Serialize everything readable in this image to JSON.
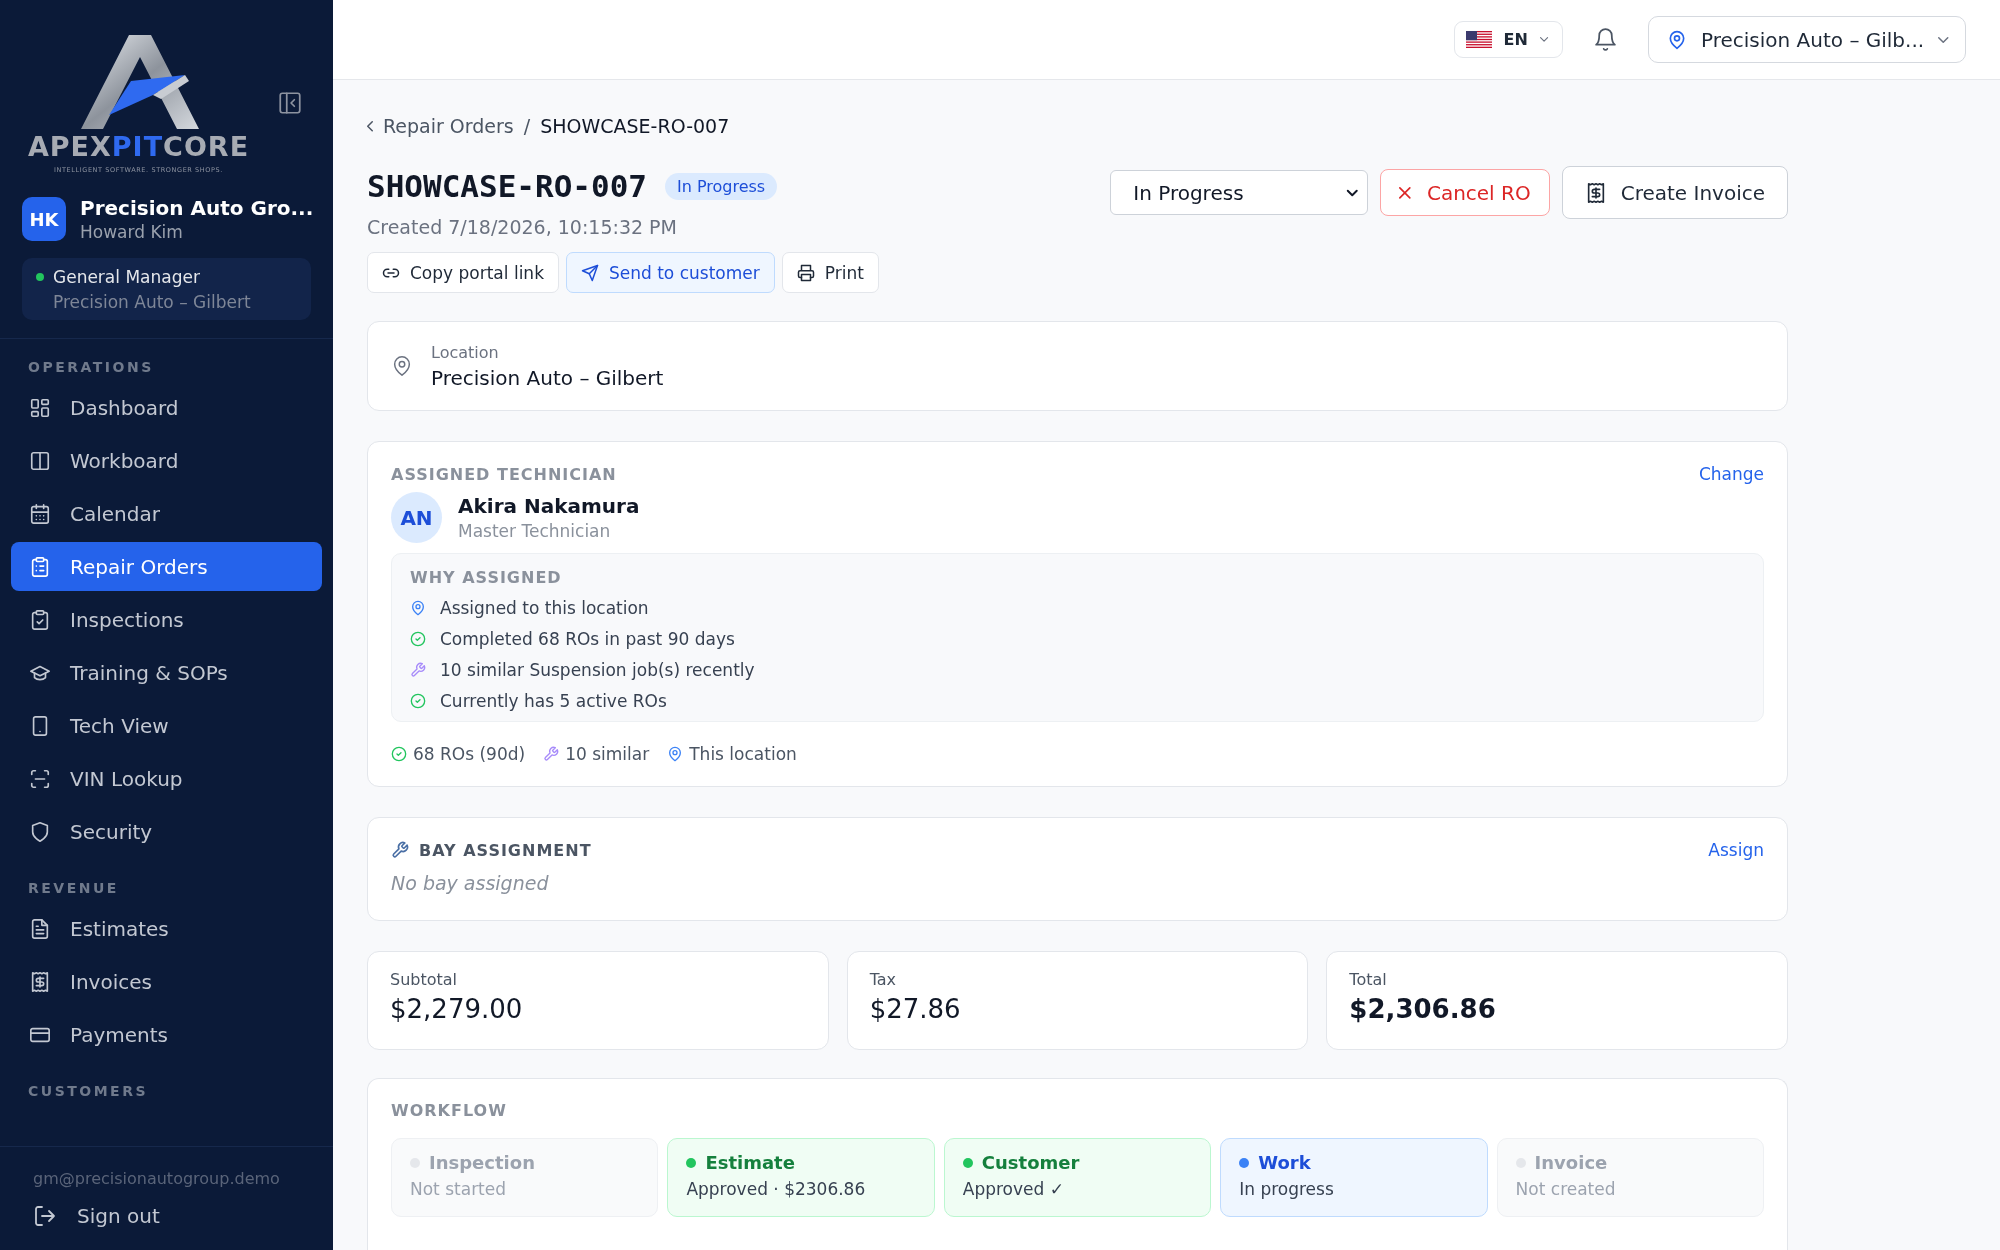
{
  "sidebar": {
    "logo": {
      "wordmark": [
        {
          "text": "APEX",
          "accent": false
        },
        {
          "text": "PIT",
          "accent": true
        },
        {
          "text": "CORE",
          "accent": false
        }
      ],
      "tagline": "INTELLIGENT SOFTWARE. STRONGER SHOPS."
    },
    "account": {
      "initials": "HK",
      "organization": "Precision Auto Gro...",
      "user": "Howard Kim"
    },
    "role": {
      "title": "General Manager",
      "location": "Precision Auto – Gilbert",
      "online": true
    },
    "sections": [
      {
        "heading": "OPERATIONS",
        "items": [
          {
            "label": "Dashboard",
            "selected": false
          },
          {
            "label": "Workboard",
            "selected": false
          },
          {
            "label": "Calendar",
            "selected": false
          },
          {
            "label": "Repair Orders",
            "selected": true
          },
          {
            "label": "Inspections",
            "selected": false
          },
          {
            "label": "Training & SOPs",
            "selected": false
          },
          {
            "label": "Tech View",
            "selected": false
          },
          {
            "label": "VIN Lookup",
            "selected": false
          },
          {
            "label": "Security",
            "selected": false
          }
        ]
      },
      {
        "heading": "REVENUE",
        "items": [
          {
            "label": "Estimates",
            "selected": false
          },
          {
            "label": "Invoices",
            "selected": false
          },
          {
            "label": "Payments",
            "selected": false
          }
        ]
      },
      {
        "heading": "CUSTOMERS"
      }
    ],
    "email": "gm@precisionautogroup.demo",
    "sign_out": "Sign out"
  },
  "topbar": {
    "language": "EN",
    "location": "Precision Auto – Gilb..."
  },
  "breadcrumb": {
    "parent": "Repair Orders",
    "separator": "/",
    "current": "SHOWCASE-RO-007"
  },
  "header": {
    "title": "SHOWCASE-RO-007",
    "status_badge": "In Progress",
    "created": "Created 7/18/2026, 10:15:32 PM",
    "status_select": "In Progress",
    "cancel_button": "Cancel RO",
    "invoice_button": "Create Invoice",
    "actions": [
      {
        "label": "Copy portal link",
        "kind": "link"
      },
      {
        "label": "Send to customer",
        "kind": "send"
      },
      {
        "label": "Print",
        "kind": "print"
      }
    ]
  },
  "location_card": {
    "label": "Location",
    "value": "Precision Auto – Gilbert"
  },
  "technician": {
    "heading": "ASSIGNED TECHNICIAN",
    "change_link": "Change",
    "initials": "AN",
    "name": "Akira Nakamura",
    "role": "Master Technician",
    "why_heading": "WHY ASSIGNED",
    "reasons": [
      {
        "kind": "location",
        "text": "Assigned to this location"
      },
      {
        "kind": "check",
        "text": "Completed 68 ROs in past 90 days"
      },
      {
        "kind": "similar",
        "text": "10 similar Suspension job(s) recently"
      },
      {
        "kind": "check",
        "text": "Currently has 5 active ROs"
      }
    ],
    "stats": [
      {
        "kind": "check",
        "text": "68 ROs (90d)"
      },
      {
        "kind": "similar",
        "text": "10 similar"
      },
      {
        "kind": "location",
        "text": "This location"
      }
    ]
  },
  "bay": {
    "heading": "BAY ASSIGNMENT",
    "assign_link": "Assign",
    "empty_text": "No bay assigned"
  },
  "totals": [
    {
      "label": "Subtotal",
      "value": "$2,279.00",
      "grand_total": false
    },
    {
      "label": "Tax",
      "value": "$27.86",
      "grand_total": false
    },
    {
      "label": "Total",
      "value": "$2,306.86",
      "grand_total": true
    }
  ],
  "workflow": {
    "heading": "WORKFLOW",
    "steps": [
      {
        "title": "Inspection",
        "detail": "Not started",
        "done": false,
        "current": false
      },
      {
        "title": "Estimate",
        "detail": "Approved · $2306.86",
        "done": true,
        "current": false
      },
      {
        "title": "Customer",
        "detail": "Approved ✓",
        "done": true,
        "current": false
      },
      {
        "title": "Work",
        "detail": "In progress",
        "done": false,
        "current": true
      },
      {
        "title": "Invoice",
        "detail": "Not created",
        "done": false,
        "current": false
      }
    ]
  }
}
